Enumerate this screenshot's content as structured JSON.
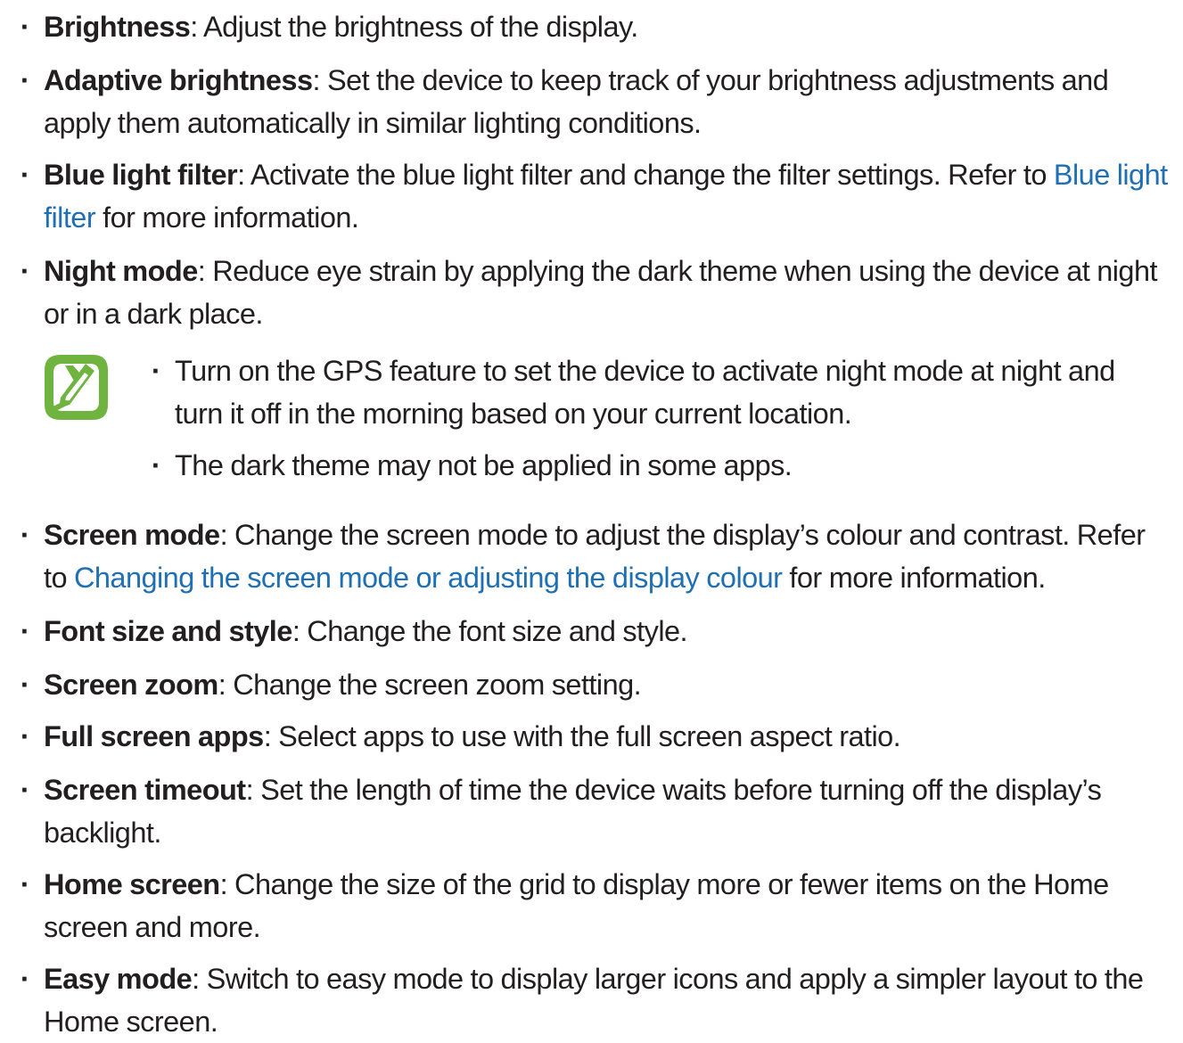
{
  "bullet_glyph": "·",
  "items": [
    {
      "term": "Brightness",
      "sep": ": ",
      "text": "Adjust the brightness of the display.",
      "link": "",
      "after": ""
    },
    {
      "term": "Adaptive brightness",
      "sep": ": ",
      "text": "Set the device to keep track of your brightness adjustments and apply them automatically in similar lighting conditions.",
      "link": "",
      "after": ""
    },
    {
      "term": "Blue light filter",
      "sep": ": ",
      "text": "Activate the blue light filter and change the filter settings. Refer to ",
      "link": "Blue light filter",
      "after": " for more information."
    },
    {
      "term": "Night mode",
      "sep": ": ",
      "text": "Reduce eye strain by applying the dark theme when using the device at night or in a dark place.",
      "link": "",
      "after": ""
    },
    {
      "term": "Screen mode",
      "sep": ": ",
      "text": "Change the screen mode to adjust the display’s colour and contrast. Refer to ",
      "link": "Changing the screen mode or adjusting the display colour",
      "after": " for more information."
    },
    {
      "term": "Font size and style",
      "sep": ": ",
      "text": "Change the font size and style.",
      "link": "",
      "after": ""
    },
    {
      "term": "Screen zoom",
      "sep": ": ",
      "text": "Change the screen zoom setting.",
      "link": "",
      "after": ""
    },
    {
      "term": "Full screen apps",
      "sep": ": ",
      "text": "Select apps to use with the full screen aspect ratio.",
      "link": "",
      "after": ""
    },
    {
      "term": "Screen timeout",
      "sep": ": ",
      "text": "Set the length of time the device waits before turning off the display’s backlight.",
      "link": "",
      "after": ""
    },
    {
      "term": "Home screen",
      "sep": ": ",
      "text": "Change the size of the grid to display more or fewer items on the Home screen and more.",
      "link": "",
      "after": ""
    },
    {
      "term": "Easy mode",
      "sep": ": ",
      "text": "Switch to easy mode to display larger icons and apply a simpler layout to the Home screen.",
      "link": "",
      "after": ""
    }
  ],
  "note": {
    "icon": "note-pencil-icon",
    "icon_color": "#6fb43f",
    "items": [
      "Turn on the GPS feature to set the device to activate night mode at night and turn it off in the morning based on your current location.",
      "The dark theme may not be applied in some apps."
    ]
  },
  "colors": {
    "text": "#231f20",
    "link": "#1e6fb3",
    "note_icon": "#6fb43f"
  }
}
